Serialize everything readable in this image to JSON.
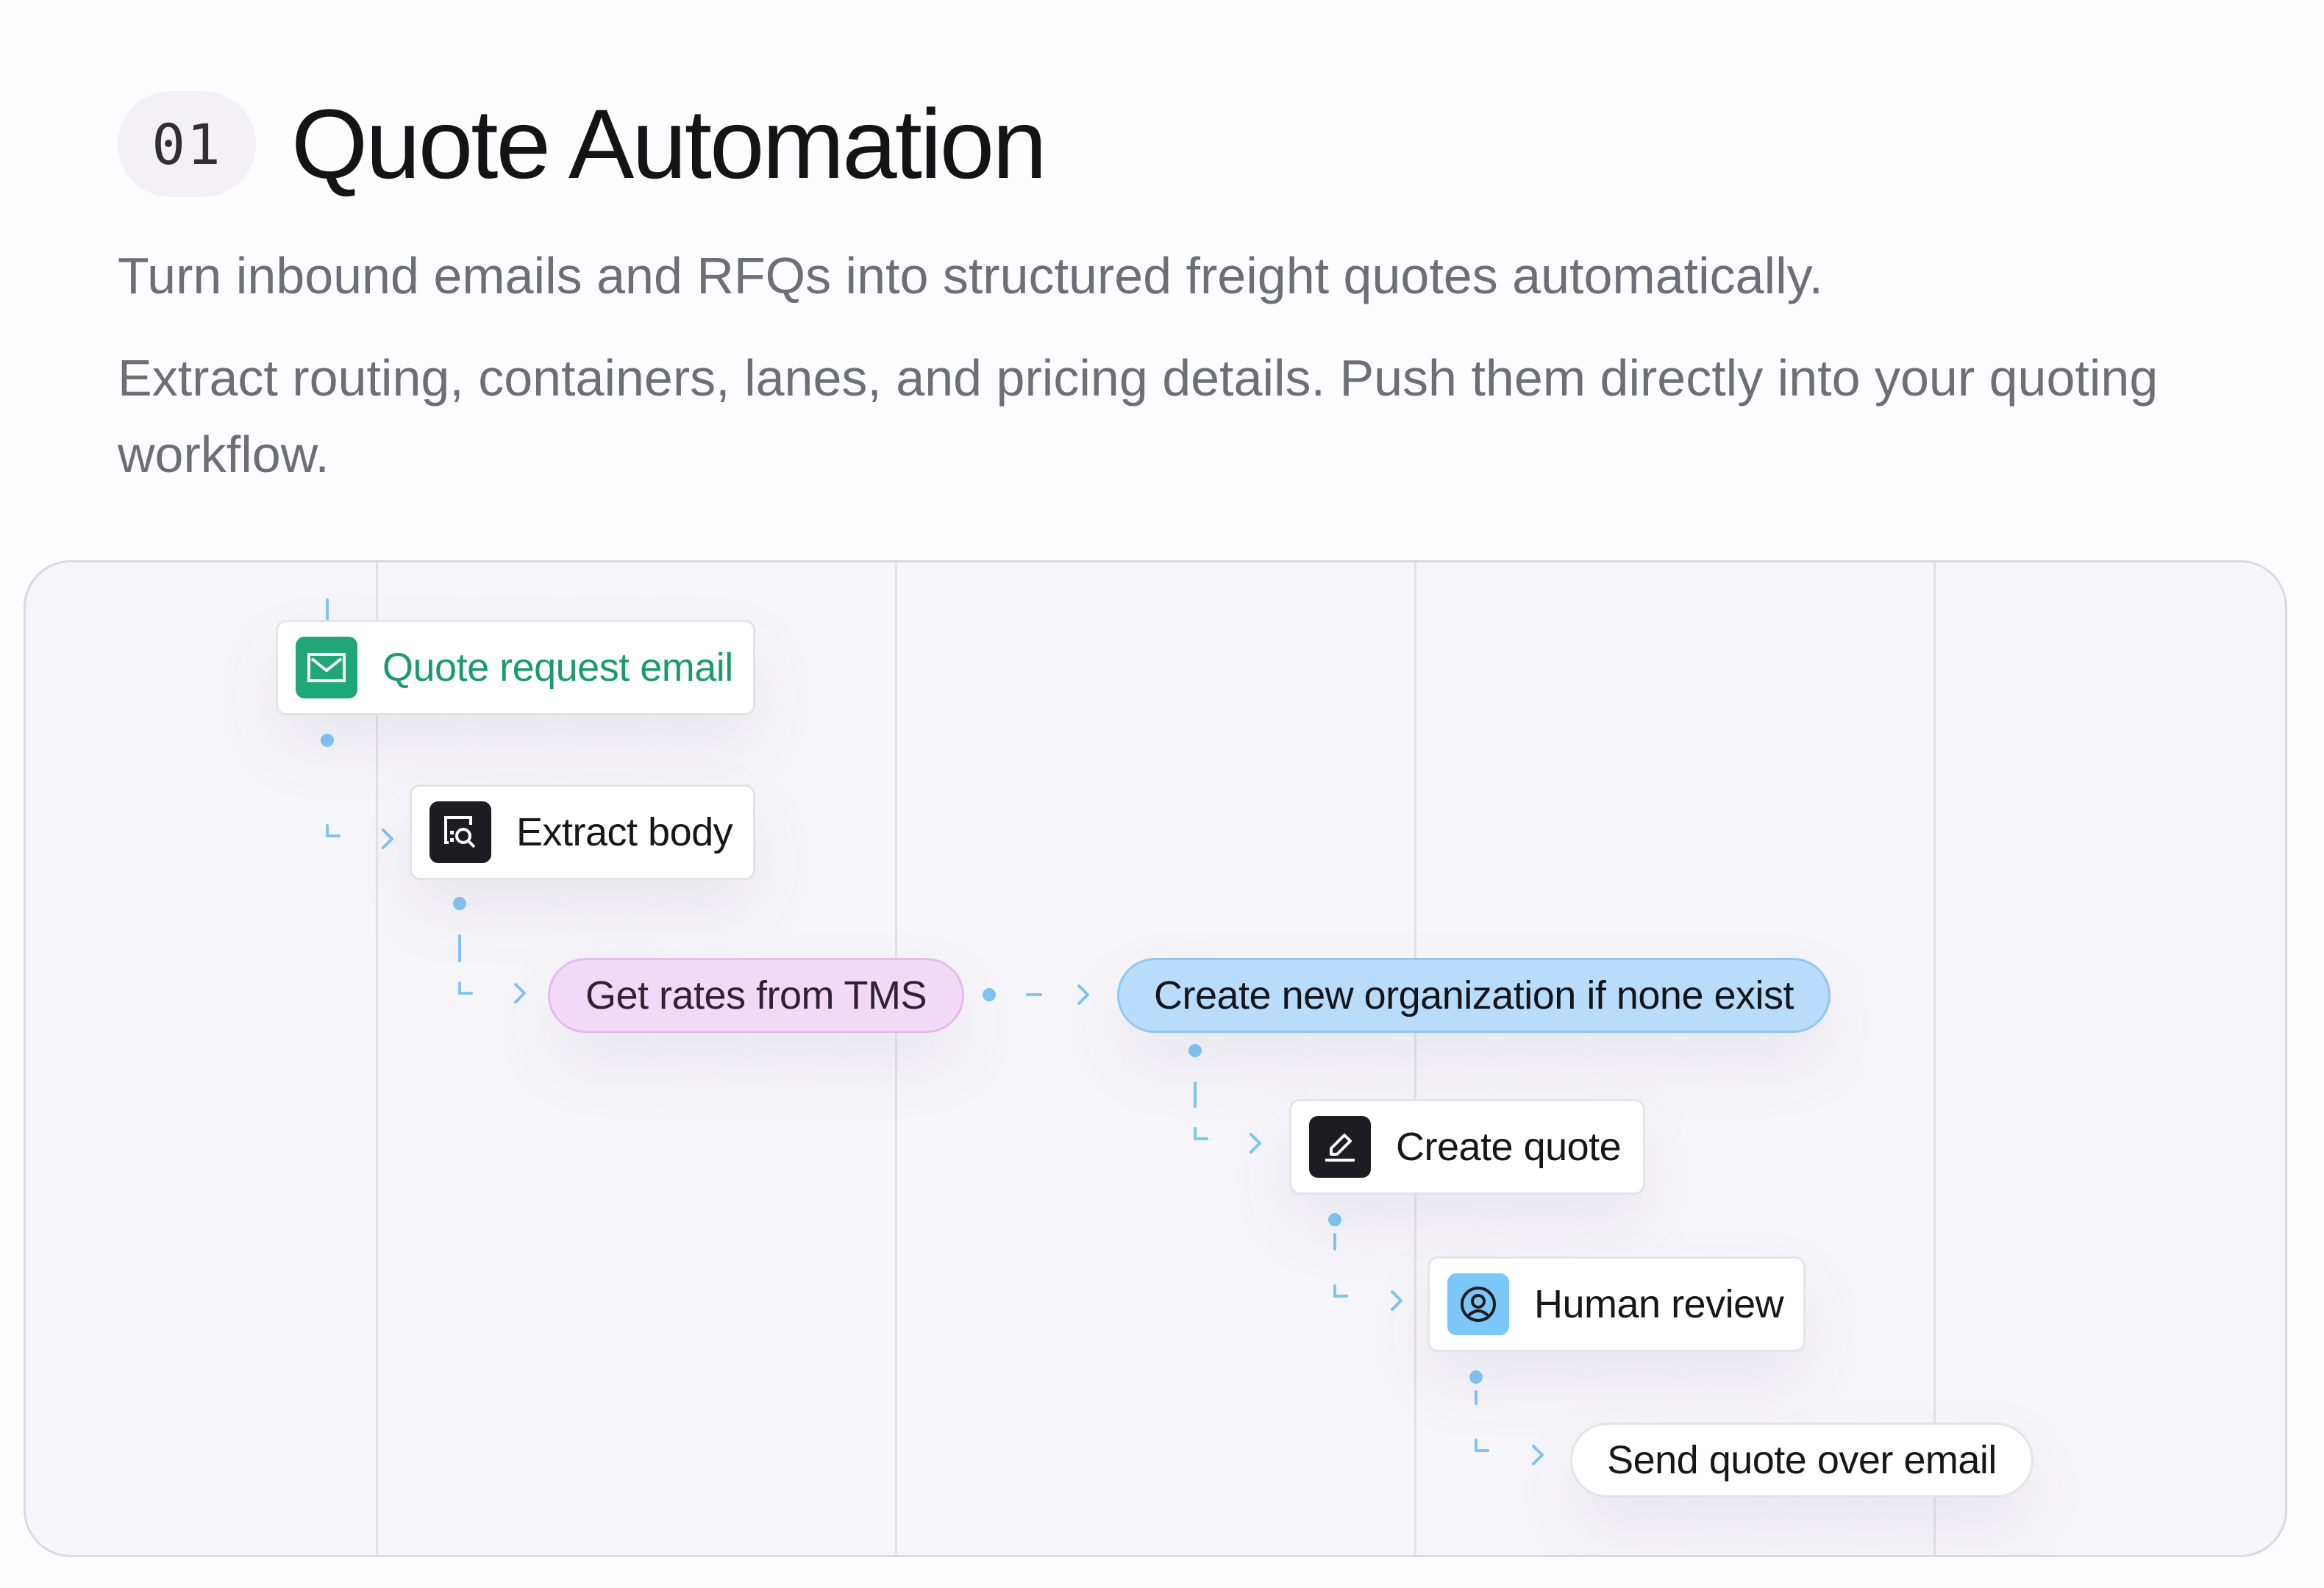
{
  "section": {
    "number": "01",
    "title": "Quote Automation",
    "subtitle": "Turn inbound emails and RFQs into structured freight quotes automatically.",
    "description": "Extract routing, containers, lanes, and pricing details. Push them directly into your quoting workflow."
  },
  "workflow": {
    "steps": {
      "quote_request_email": "Quote request email",
      "extract_body": "Extract body",
      "get_rates": "Get rates from TMS",
      "create_org": "Create new organization if none exist",
      "create_quote": "Create quote",
      "human_review": "Human review",
      "send_quote": "Send quote over email"
    },
    "icons": {
      "quote_request_email": "mail-icon",
      "extract_body": "document-search-icon",
      "create_quote": "pencil-icon",
      "human_review": "user-circle-icon"
    }
  },
  "colors": {
    "email_green": "#1fa77a",
    "connector_blue": "#7fc4f2",
    "rates_purple_fill": "#f2d9f7",
    "org_blue_fill": "#b9dcfa",
    "review_blue_icon": "#7dc6f8",
    "dark_icon": "#1c1c21"
  }
}
